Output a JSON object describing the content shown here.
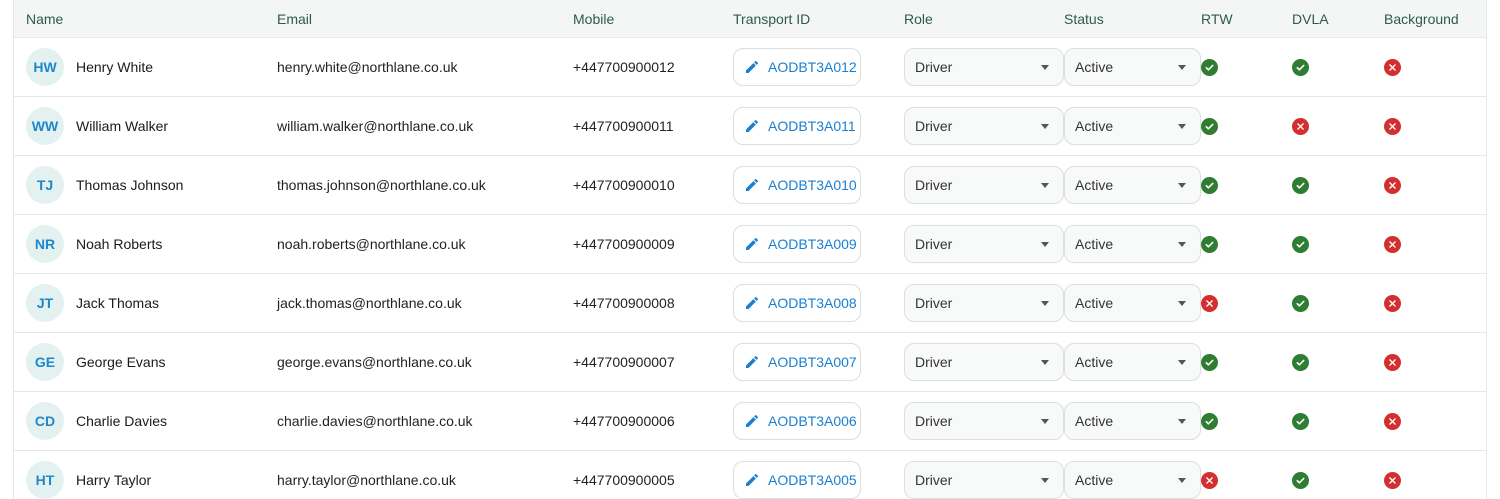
{
  "columns": {
    "name": "Name",
    "email": "Email",
    "mobile": "Mobile",
    "transport_id": "Transport ID",
    "role": "Role",
    "status": "Status",
    "rtw": "RTW",
    "dvla": "DVLA",
    "background": "Background"
  },
  "icons": {
    "edit": "pencil-icon",
    "dropdown": "chevron-down-icon",
    "pass": "check-circle-icon",
    "fail": "x-circle-icon"
  },
  "colors": {
    "pass": "#2e7d32",
    "fail": "#d32f2f",
    "accent": "#1a7fd1"
  },
  "rows": [
    {
      "initials": "HW",
      "name": "Henry White",
      "email": "henry.white@northlane.co.uk",
      "mobile": "+447700900012",
      "transport_id": "AODBT3A012",
      "role": "Driver",
      "status": "Active",
      "rtw": true,
      "dvla": true,
      "background": false
    },
    {
      "initials": "WW",
      "name": "William Walker",
      "email": "william.walker@northlane.co.uk",
      "mobile": "+447700900011",
      "transport_id": "AODBT3A011",
      "role": "Driver",
      "status": "Active",
      "rtw": true,
      "dvla": false,
      "background": false
    },
    {
      "initials": "TJ",
      "name": "Thomas Johnson",
      "email": "thomas.johnson@northlane.co.uk",
      "mobile": "+447700900010",
      "transport_id": "AODBT3A010",
      "role": "Driver",
      "status": "Active",
      "rtw": true,
      "dvla": true,
      "background": false
    },
    {
      "initials": "NR",
      "name": "Noah Roberts",
      "email": "noah.roberts@northlane.co.uk",
      "mobile": "+447700900009",
      "transport_id": "AODBT3A009",
      "role": "Driver",
      "status": "Active",
      "rtw": true,
      "dvla": true,
      "background": false
    },
    {
      "initials": "JT",
      "name": "Jack Thomas",
      "email": "jack.thomas@northlane.co.uk",
      "mobile": "+447700900008",
      "transport_id": "AODBT3A008",
      "role": "Driver",
      "status": "Active",
      "rtw": false,
      "dvla": true,
      "background": false
    },
    {
      "initials": "GE",
      "name": "George Evans",
      "email": "george.evans@northlane.co.uk",
      "mobile": "+447700900007",
      "transport_id": "AODBT3A007",
      "role": "Driver",
      "status": "Active",
      "rtw": true,
      "dvla": true,
      "background": false
    },
    {
      "initials": "CD",
      "name": "Charlie Davies",
      "email": "charlie.davies@northlane.co.uk",
      "mobile": "+447700900006",
      "transport_id": "AODBT3A006",
      "role": "Driver",
      "status": "Active",
      "rtw": true,
      "dvla": true,
      "background": false
    },
    {
      "initials": "HT",
      "name": "Harry Taylor",
      "email": "harry.taylor@northlane.co.uk",
      "mobile": "+447700900005",
      "transport_id": "AODBT3A005",
      "role": "Driver",
      "status": "Active",
      "rtw": false,
      "dvla": true,
      "background": false
    }
  ]
}
